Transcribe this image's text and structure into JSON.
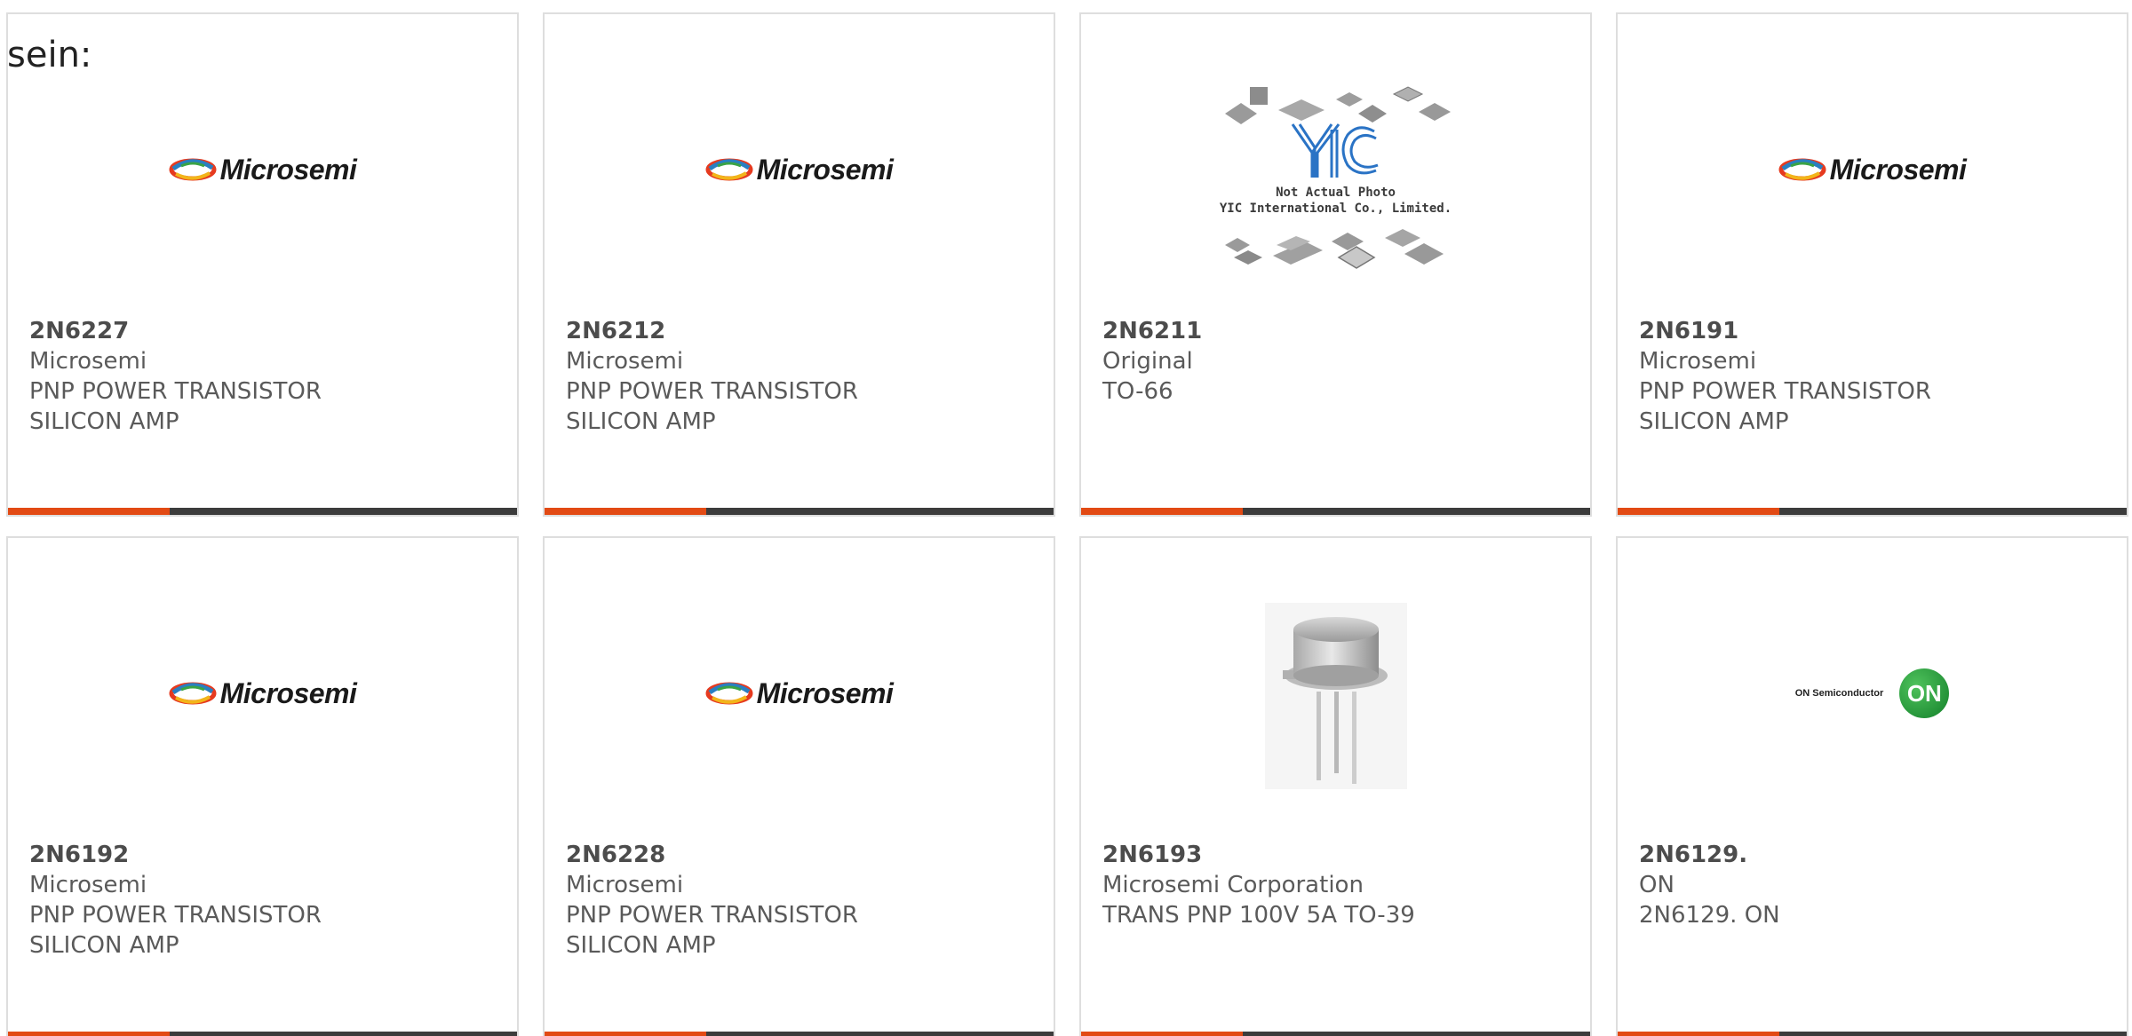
{
  "intro_text": "sein:",
  "colors": {
    "accent": "#e24a14",
    "bar": "#3c3c3c",
    "border": "#dedede"
  },
  "products": [
    {
      "part": "2N6227",
      "manufacturer": "Microsemi",
      "description_line1": "PNP POWER TRANSISTOR",
      "description_line2": "SILICON AMP",
      "image": "microsemi-logo",
      "logo_text": "Microsemi"
    },
    {
      "part": "2N6212",
      "manufacturer": "Microsemi",
      "description_line1": "PNP POWER TRANSISTOR",
      "description_line2": "SILICON AMP",
      "image": "microsemi-logo",
      "logo_text": "Microsemi"
    },
    {
      "part": "2N6211",
      "manufacturer": "Original",
      "description_line1": "TO-66",
      "description_line2": "",
      "image": "yic-placeholder",
      "caption_line1": "Not Actual Photo",
      "caption_line2": "YIC International Co., Limited."
    },
    {
      "part": "2N6191",
      "manufacturer": "Microsemi",
      "description_line1": "PNP POWER TRANSISTOR",
      "description_line2": "SILICON AMP",
      "image": "microsemi-logo",
      "logo_text": "Microsemi"
    },
    {
      "part": "2N6192",
      "manufacturer": "Microsemi",
      "description_line1": "PNP POWER TRANSISTOR",
      "description_line2": "SILICON AMP",
      "image": "microsemi-logo",
      "logo_text": "Microsemi"
    },
    {
      "part": "2N6228",
      "manufacturer": "Microsemi",
      "description_line1": "PNP POWER TRANSISTOR",
      "description_line2": "SILICON AMP",
      "image": "microsemi-logo",
      "logo_text": "Microsemi"
    },
    {
      "part": "2N6193",
      "manufacturer": "Microsemi Corporation",
      "description_line1": "TRANS PNP 100V 5A TO-39",
      "description_line2": "",
      "image": "to39-transistor-photo"
    },
    {
      "part": "2N6129.",
      "manufacturer": "ON",
      "description_line1": "2N6129. ON",
      "description_line2": "",
      "image": "on-semiconductor-logo",
      "logo_text": "ON Semiconductor",
      "logo_badge": "ON"
    }
  ]
}
